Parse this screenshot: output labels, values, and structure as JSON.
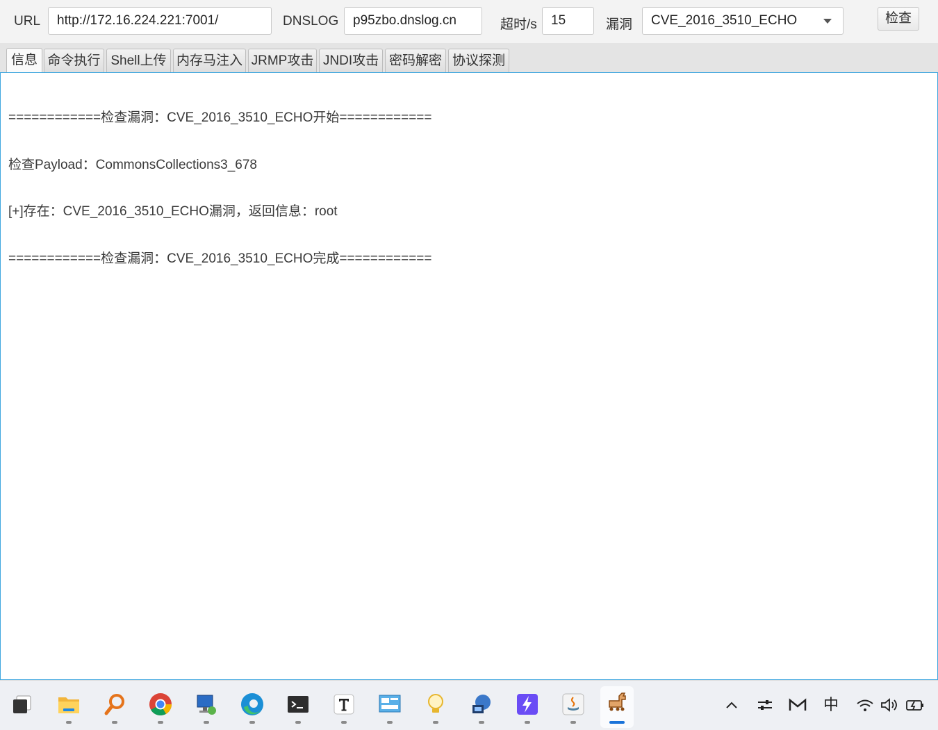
{
  "form": {
    "url_label": "URL",
    "url_value": "http://172.16.224.221:7001/",
    "dnslog_label": "DNSLOG",
    "dnslog_value": "p95zbo.dnslog.cn",
    "timeout_label": "超时/s",
    "timeout_value": "15",
    "vuln_label": "漏洞",
    "vuln_selected": "CVE_2016_3510_ECHO",
    "check_button": "检查"
  },
  "tabs": [
    {
      "label": "信息",
      "active": true
    },
    {
      "label": "命令执行"
    },
    {
      "label": "Shell上传"
    },
    {
      "label": "内存马注入"
    },
    {
      "label": "JRMP攻击"
    },
    {
      "label": "JNDI攻击"
    },
    {
      "label": "密码解密"
    },
    {
      "label": "协议探测"
    }
  ],
  "log": [
    "============检查漏洞：CVE_2016_3510_ECHO开始============",
    "检查Payload：CommonsCollections3_678",
    "[+]存在：CVE_2016_3510_ECHO漏洞，返回信息：root",
    "============检查漏洞：CVE_2016_3510_ECHO完成============"
  ],
  "taskbar": {
    "apps": [
      {
        "icon": "task-view-icon"
      },
      {
        "icon": "file-explorer-icon"
      },
      {
        "icon": "search-tool-icon"
      },
      {
        "icon": "chrome-icon"
      },
      {
        "icon": "remote-desktop-icon"
      },
      {
        "icon": "edge-icon"
      },
      {
        "icon": "terminal-icon"
      },
      {
        "icon": "typora-icon"
      },
      {
        "icon": "monitor-app-icon"
      },
      {
        "icon": "lightbulb-app-icon"
      },
      {
        "icon": "network-tool-icon"
      },
      {
        "icon": "lightning-app-icon"
      },
      {
        "icon": "java-icon"
      },
      {
        "icon": "trojan-horse-icon",
        "active": true
      }
    ],
    "tray": {
      "ime_label": "中",
      "icons": [
        "chevron-up-icon",
        "settings-sliders-icon",
        "gmail-icon",
        "wifi-icon",
        "volume-icon",
        "battery-charging-icon"
      ]
    }
  },
  "colors": {
    "content_border": "#3fa7df",
    "taskbar_active_indicator": "#1a73d9"
  }
}
